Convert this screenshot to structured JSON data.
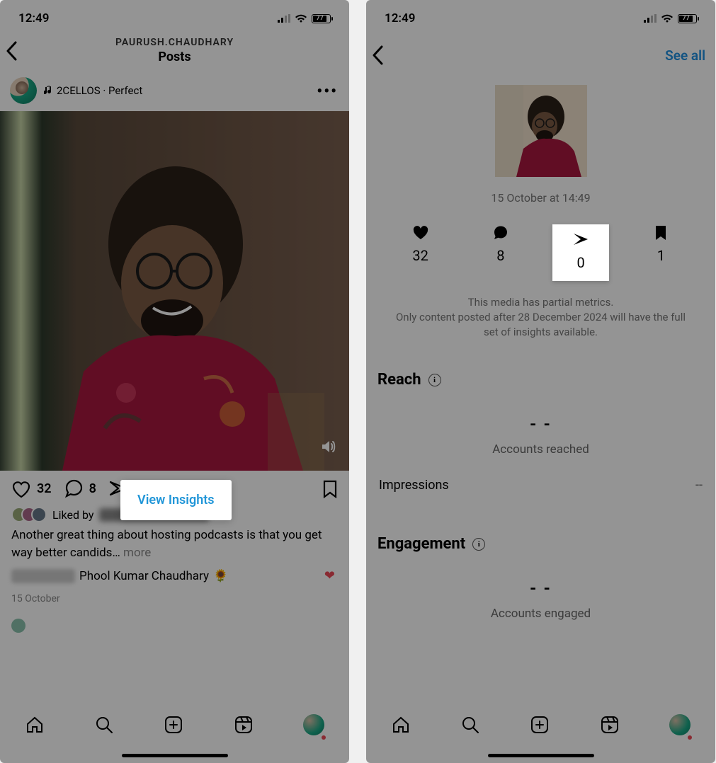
{
  "status": {
    "time": "12:49",
    "battery_pct": "77"
  },
  "left": {
    "username": "PAURUSH.CHAUDHARY",
    "header_title": "Posts",
    "music_text": "2CELLOS · Perfect",
    "view_insights": "View Insights",
    "likes_count": "32",
    "comments_count": "8",
    "liked_by_prefix": "Liked by",
    "caption_text": "Another great thing about hosting podcasts is that you get way better candids…",
    "more_label": "more",
    "tag_name": "Phool Kumar Chaudhary",
    "sunflower": "🌻",
    "post_date": "15 October"
  },
  "right": {
    "see_all": "See all",
    "post_timestamp": "15 October at 14:49",
    "metric_likes": "32",
    "metric_comments": "8",
    "metric_shares": "0",
    "metric_saves": "1",
    "partial_line1": "This media has partial metrics.",
    "partial_line2": "Only content posted after 28 December 2024 will have the full set of insights available.",
    "reach_title": "Reach",
    "reach_dashes": "- -",
    "accounts_reached": "Accounts reached",
    "impressions_label": "Impressions",
    "impressions_value": "--",
    "engagement_title": "Engagement",
    "engagement_dashes": "- -",
    "accounts_engaged": "Accounts engaged"
  }
}
